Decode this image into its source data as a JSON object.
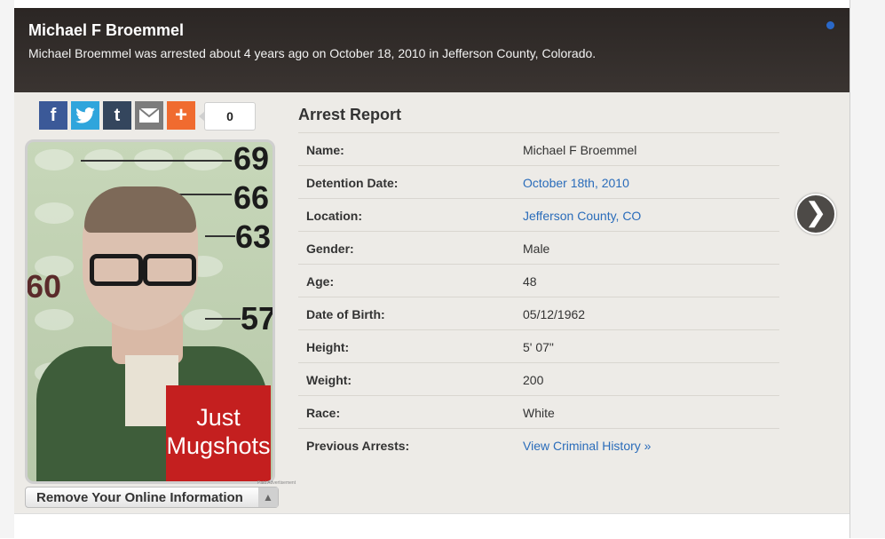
{
  "header": {
    "title": "Michael F Broemmel",
    "subtitle": "Michael Broemmel was arrested about 4 years ago on October 18, 2010 in Jefferson County, Colorado."
  },
  "share": {
    "facebook_icon": "f",
    "twitter_icon": "t-bird",
    "tumblr_icon": "t",
    "email_icon": "envelope",
    "plus_icon": "+",
    "count": "0"
  },
  "mugshot": {
    "height_marks": [
      "69",
      "66",
      "63",
      "60",
      "57"
    ],
    "badge_line1": "Just",
    "badge_line2": "Mugshots",
    "ad_label": "Paid Advertisement",
    "remove_label": "Remove Your Online Information",
    "remove_arrow": "▲"
  },
  "report": {
    "title": "Arrest Report",
    "rows": [
      {
        "label": "Name:",
        "value": "Michael F Broemmel"
      },
      {
        "label": "Detention Date:",
        "value": "October 18th, 2010"
      },
      {
        "label": "Location:",
        "value": "Jefferson County, CO"
      },
      {
        "label": "Gender:",
        "value": "Male"
      },
      {
        "label": "Age:",
        "value": "48"
      },
      {
        "label": "Date of Birth:",
        "value": "05/12/1962"
      },
      {
        "label": "Height:",
        "value": "5' 07\""
      },
      {
        "label": "Weight:",
        "value": "200"
      },
      {
        "label": "Race:",
        "value": "White"
      },
      {
        "label": "Previous Arrests:",
        "value": "View Criminal History »"
      }
    ]
  },
  "nav": {
    "next_glyph": "❯"
  },
  "colors": {
    "header_bg": "#2b2624",
    "link": "#2a6cba",
    "badge": "#c41f1f",
    "indicator": "#2a68c8"
  }
}
